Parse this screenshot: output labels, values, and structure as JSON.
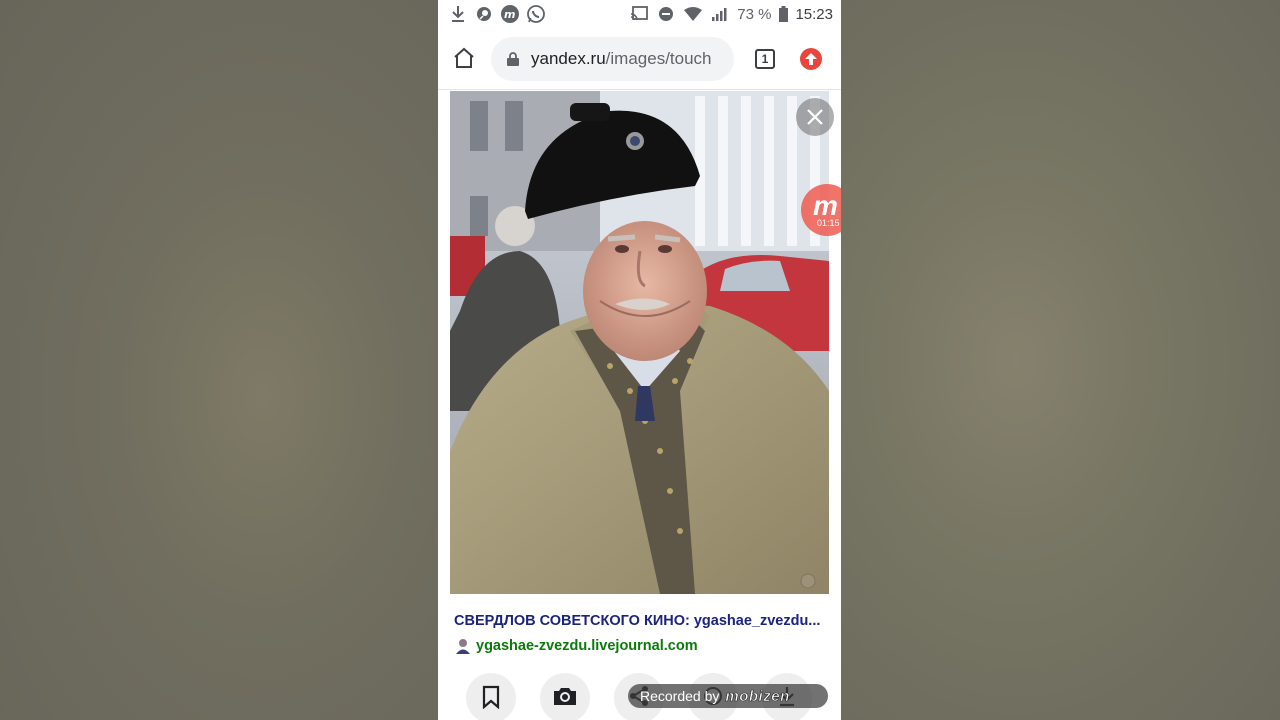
{
  "status_bar": {
    "battery": "73 %",
    "time": "15:23",
    "left_icons": [
      "download-icon",
      "chat-search-icon",
      "mobizen-icon",
      "whatsapp-icon"
    ],
    "right_icons": [
      "cast-icon",
      "do-not-disturb-icon",
      "wifi-icon",
      "signal-icon",
      "battery-icon"
    ]
  },
  "browser": {
    "url_domain": "yandex.ru",
    "url_path": "/images/touch",
    "tab_count": "1"
  },
  "overlay": {
    "recorder_logo": "m",
    "recorder_time": "01:15"
  },
  "result": {
    "title": "СВЕРДЛОВ СОВЕТСКОГО КИНО: ygashae_zvezdu...",
    "source": "ygashae-zvezdu.livejournal.com"
  },
  "actions": [
    "bookmark-icon",
    "camera-search-icon",
    "share-icon",
    "more-icon",
    "download-icon"
  ],
  "watermark": {
    "prefix": "Recorded by",
    "brand": "mobizen"
  },
  "colors": {
    "accent_red": "#e8453c",
    "title_blue": "#1a237e",
    "link_green": "#0b7a0b"
  }
}
